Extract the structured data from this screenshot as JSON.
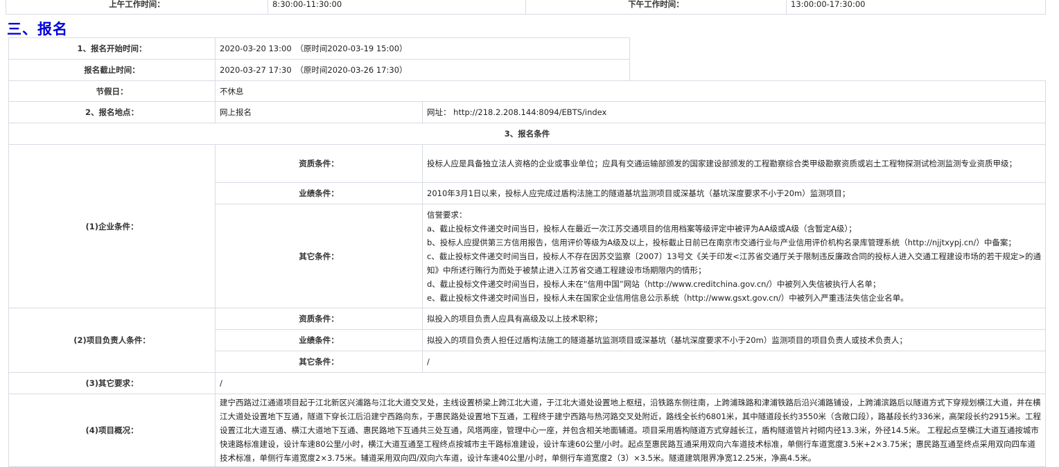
{
  "work_hours": {
    "morning_label": "上午工作时间：",
    "morning_value": "8:30:00-11:30:00",
    "afternoon_label": "下午工作时间：",
    "afternoon_value": "13:00:00-17:30:00"
  },
  "section_title": "三、报名",
  "registration": {
    "start_label": "1、报名开始时间：",
    "start_value": "2020-03-20 13:00　（原时间2020-03-19 15:00）",
    "end_label": "报名截止时间：",
    "end_value": "2020-03-27 17:30　（原时间2020-03-26 17:30）",
    "holiday_label": "节假日：",
    "holiday_value": "不休息",
    "location_label": "2、报名地点：",
    "location_value": "网上报名",
    "location_url": "网址： http://218.2.208.144:8094/EBTS/index",
    "conditions_header": "3、报名条件"
  },
  "enterprise": {
    "label": "(1)企业条件：",
    "qual_label": "资质条件：",
    "qual_value": "投标人应是具备独立法人资格的企业或事业单位；应具有交通运输部颁发的国家建设部颁发的工程勘察综合类甲级勘察资质或岩土工程物探测试检测监测专业资质甲级；",
    "perf_label": "业绩条件：",
    "perf_value": "2010年3月1日以来，投标人应完成过盾构法施工的隧道基坑监测项目或深基坑（基坑深度要求不小于20m）监测项目；",
    "other_label": "其它条件：",
    "other_lines": [
      "信誉要求：",
      "a、截止投标文件递交时间当日，投标人在最近一次江苏交通项目的信用档案等级评定中被评为AA级或A级（含暂定A级）；",
      "b、投标人应提供第三方信用报告，信用评价等级为A级及以上，投标截止日前已在南京市交通行业与产业信用评价机构名录库管理系统（http://njjtxypj.cn/）中备案；",
      "c、截止投标文件递交时间当日，投标人不存在因苏交监察〔2007〕13号文《关于印发<江苏省交通厅关于限制违反廉政合同的投标人进入交通工程建设市场的若干规定>的通知》中所述行贿行为而处于被禁止进入江苏省交通工程建设市场期限内的情形；",
      "d、截止投标文件递交时间当日，投标人未在“信用中国”网站（http://www.creditchina.gov.cn/）中被列入失信被执行人名单；",
      "e、截止投标文件递交时间当日，投标人未在国家企业信用信息公示系统（http://www.gsxt.gov.cn/）中被列入严重违法失信企业名单。"
    ]
  },
  "manager": {
    "label": "(2)项目负责人条件：",
    "qual_label": "资质条件：",
    "qual_value": "拟投入的项目负责人应具有高级及以上技术职称；",
    "perf_label": "业绩条件：",
    "perf_value": "拟投入的项目负责人担任过盾构法施工的隧道基坑监测项目或深基坑（基坑深度要求不小于20m）监测项目的项目负责人或技术负责人；",
    "other_label": "其它条件：",
    "other_value": "/"
  },
  "other_req": {
    "label": "(3)其它要求：",
    "value": "/"
  },
  "overview": {
    "label": "(4)项目概况：",
    "value": "建宁西路过江通道项目起于江北新区兴浦路与江北大道交叉处，主线设置桥梁上跨江北大道，于江北大道处设置地上枢纽，沿铁路东侧往南，上跨浦珠路和津浦铁路后沿兴浦路铺设，上跨浦滨路后以隧道方式下穿规划横江大道，并在横江大道处设置地下互通，隧道下穿长江后沿建宁西路向东，于惠民路处设置地下互通，工程终于建宁西路与热河路交叉处附近，路线全长约6801米，其中隧道段长约3550米（含敞口段），路基段长约336米，高架段长约2915米。工程设置江北大道互通、横江大道地下互通、惠民路地下互通共三处互通，风塔两座，管理中心一座，并包含相关地面辅道。项目采用盾构隧道方式穿越长江，盾构隧道管片衬砌内径13.3米，外径14.5米。 工程起点至横江大道互通按城市快速路标准建设，设计车速80公里/小时，横江大道互通至工程终点按城市主干路标准建设，设计车速60公里/小时。起点至惠民路互通采用双向六车道技术标准，单侧行车道宽度3.5米+2×3.75米；惠民路互通至终点采用双向四车道技术标准，单侧行车道宽度2×3.75米。辅道采用双向四/双向六车道，设计车速40公里/小时，单侧行车道宽度2（3）×3.5米。隧道建筑限界净宽12.25米，净高4.5米。"
  }
}
